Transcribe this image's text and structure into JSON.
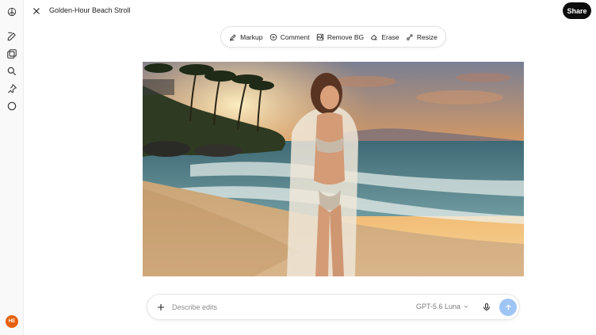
{
  "header": {
    "title": "Golden-Hour Beach Stroll",
    "share_label": "Share"
  },
  "sidebar": {
    "icons": [
      "chatgpt-logo-icon",
      "new-chat-icon",
      "gallery-icon",
      "search-icon",
      "pin-icon",
      "circle-icon"
    ],
    "avatar_initials": "HE",
    "avatar_color": "#e8600c"
  },
  "toolbar": {
    "items": [
      {
        "label": "Markup",
        "icon": "markup-icon"
      },
      {
        "label": "Comment",
        "icon": "comment-icon"
      },
      {
        "label": "Remove BG",
        "icon": "remove-bg-icon"
      },
      {
        "label": "Erase",
        "icon": "eraser-icon"
      },
      {
        "label": "Resize",
        "icon": "resize-icon"
      }
    ]
  },
  "image": {
    "alt": ""
  },
  "composer": {
    "placeholder": "Describe edits",
    "value": "",
    "model_label": "GPT-5.6 Luna",
    "send_color": "#9ec5f5"
  }
}
